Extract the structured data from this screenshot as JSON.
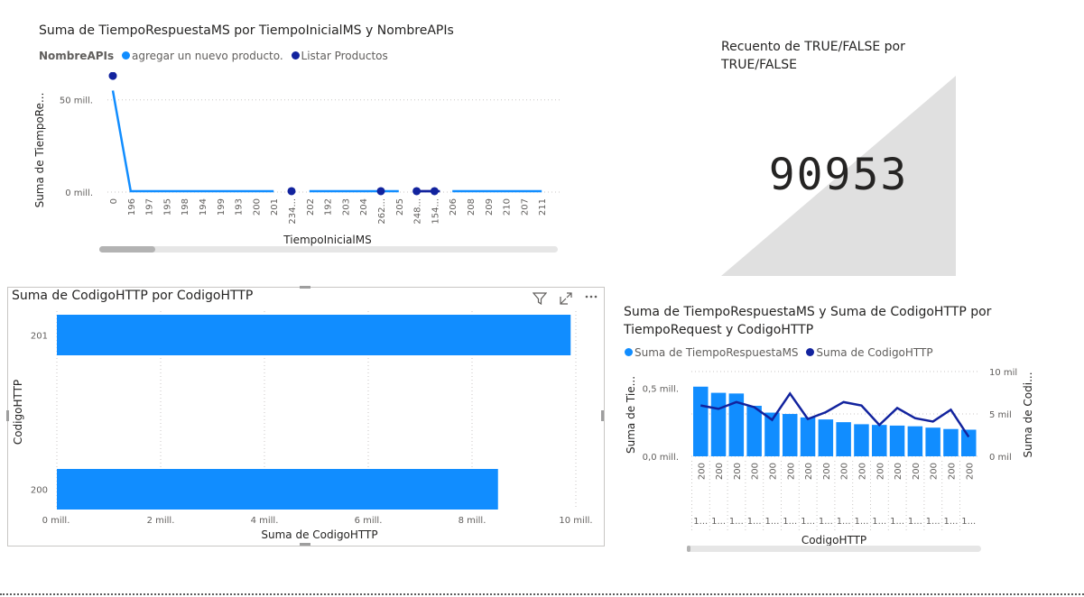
{
  "colors": {
    "light_blue": "#118DFF",
    "dark_blue": "#12239E",
    "card_bg": "#E0E0E0"
  },
  "line_chart": {
    "title": "Suma de TiempoRespuestaMS por TiempoInicialMS y NombreAPIs",
    "legend_title": "NombreAPIs",
    "legend": [
      "agregar un nuevo producto.",
      "Listar Productos"
    ],
    "ylabel": "Suma de TiempoRe...",
    "xlabel": "TiempoInicialMS"
  },
  "card": {
    "title_line1": "Recuento de TRUE/FALSE por",
    "title_line2": "TRUE/FALSE",
    "value": "90953"
  },
  "bar_chart": {
    "title": "Suma de CodigoHTTP por CodigoHTTP",
    "ylabel": "CodigoHTTP",
    "xlabel": "Suma de CodigoHTTP"
  },
  "combo_chart": {
    "title_line1": "Suma de TiempoRespuestaMS y Suma de CodigoHTTP por",
    "title_line2": "TiempoRequest y CodigoHTTP",
    "legend": [
      "Suma de TiempoRespuestaMS",
      "Suma de CodigoHTTP"
    ],
    "ylabel_left": "Suma de Tie...",
    "ylabel_right": "Suma de Codi...",
    "xlabel": "CodigoHTTP"
  },
  "chart_data": [
    {
      "type": "line",
      "title": "Suma de TiempoRespuestaMS por TiempoInicialMS y NombreAPIs",
      "xlabel": "TiempoInicialMS",
      "ylabel": "Suma de TiempoRe...",
      "x": [
        "0",
        "196",
        "197",
        "195",
        "198",
        "194",
        "199",
        "193",
        "200",
        "201",
        "234...",
        "202",
        "192",
        "203",
        "204",
        "262...",
        "205",
        "248...",
        "154...",
        "206",
        "208",
        "209",
        "210",
        "207",
        "211"
      ],
      "yticks": [
        "0 mill.",
        "50 mill."
      ],
      "ylim": [
        0,
        65000000
      ],
      "grid": true,
      "legend_position": "top-left",
      "series": [
        {
          "name": "agregar un nuevo producto.",
          "color": "#118DFF",
          "values": [
            55000000,
            500000,
            500000,
            500000,
            500000,
            500000,
            500000,
            500000,
            500000,
            500000,
            null,
            500000,
            500000,
            500000,
            500000,
            500000,
            500000,
            null,
            null,
            500000,
            500000,
            500000,
            500000,
            500000,
            500000
          ]
        },
        {
          "name": "Listar Productos",
          "color": "#12239E",
          "values": [
            63000000,
            null,
            null,
            null,
            null,
            null,
            null,
            null,
            null,
            null,
            500000,
            null,
            null,
            null,
            null,
            500000,
            null,
            500000,
            500000,
            null,
            null,
            null,
            null,
            null,
            null
          ]
        }
      ]
    },
    {
      "type": "bar",
      "orientation": "horizontal",
      "title": "Suma de CodigoHTTP por CodigoHTTP",
      "xlabel": "Suma de CodigoHTTP",
      "ylabel": "CodigoHTTP",
      "categories": [
        "201",
        "200"
      ],
      "values": [
        9900000,
        8500000
      ],
      "xticks": [
        "0 mill.",
        "2 mill.",
        "4 mill.",
        "6 mill.",
        "8 mill.",
        "10 mill."
      ],
      "xlim": [
        0,
        10000000
      ],
      "grid": true
    },
    {
      "type": "bar",
      "title": "Suma de TiempoRespuestaMS y Suma de CodigoHTTP por TiempoRequest y CodigoHTTP",
      "xlabel": "CodigoHTTP",
      "categories": [
        "200",
        "200",
        "200",
        "200",
        "200",
        "200",
        "200",
        "200",
        "200",
        "200",
        "200",
        "200",
        "200",
        "200",
        "200",
        "200"
      ],
      "sub_categories": [
        "1...",
        "1...",
        "1...",
        "1...",
        "1...",
        "1...",
        "1...",
        "1...",
        "1...",
        "1...",
        "1...",
        "1...",
        "1...",
        "1...",
        "1...",
        "1..."
      ],
      "yticks_left": [
        "0,0 mill.",
        "0,5 mill."
      ],
      "yticks_right": [
        "0 mil",
        "5 mil",
        "10 mil"
      ],
      "ylim_left": [
        0,
        700000
      ],
      "ylim_right": [
        0,
        10000
      ],
      "legend_position": "top-left",
      "series": [
        {
          "name": "Suma de TiempoRespuestaMS",
          "type": "bar",
          "axis": "left",
          "color": "#118DFF",
          "values": [
            510000,
            465000,
            460000,
            370000,
            320000,
            310000,
            285000,
            270000,
            250000,
            235000,
            230000,
            225000,
            220000,
            210000,
            200000,
            195000
          ]
        },
        {
          "name": "Suma de CodigoHTTP",
          "type": "line",
          "axis": "right",
          "color": "#12239E",
          "values": [
            6000,
            5600,
            6400,
            5800,
            4300,
            7400,
            4400,
            5200,
            6400,
            6000,
            3700,
            5700,
            4500,
            4100,
            5500,
            2300
          ]
        }
      ]
    }
  ]
}
